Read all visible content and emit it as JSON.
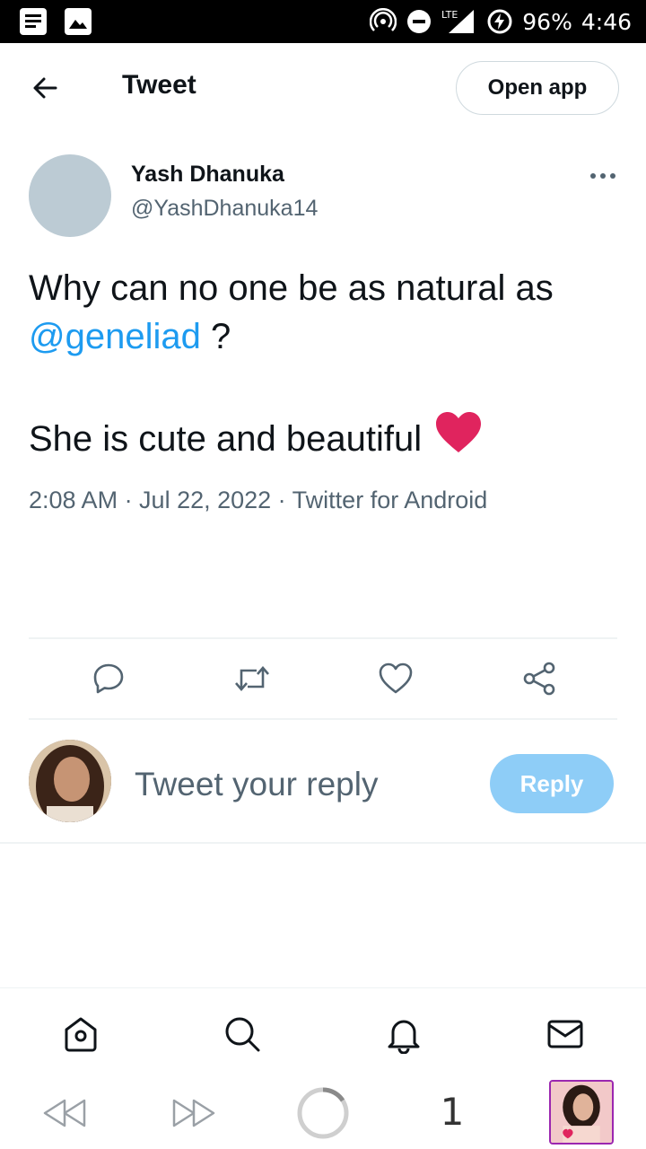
{
  "status_bar": {
    "network_label": "LTE",
    "battery": "96%",
    "time": "4:46"
  },
  "header": {
    "title": "Tweet",
    "open_app_label": "Open app"
  },
  "tweet": {
    "author_name": "Yash Dhanuka",
    "author_handle": "@YashDhanuka14",
    "line1": "Why can no one be as natural as",
    "mention": "@geneliad",
    "line1_end": " ?",
    "line2": "She is cute and beautiful",
    "emoji": "red-heart",
    "meta": "2:08 AM · Jul 22, 2022 · Twitter for Android"
  },
  "actions": [
    "reply-icon",
    "retweet-icon",
    "like-icon",
    "share-icon"
  ],
  "composer": {
    "placeholder": "Tweet your reply",
    "reply_label": "Reply"
  },
  "bottom_nav": [
    "home-icon",
    "search-icon",
    "notifications-icon",
    "messages-icon"
  ],
  "browser_toolbar": {
    "tab_count": "1"
  },
  "colors": {
    "accent": "#1d9bf0",
    "reply_button_disabled": "#8ecdf7",
    "secondary_text": "#536471",
    "heart": "#e0245e"
  }
}
